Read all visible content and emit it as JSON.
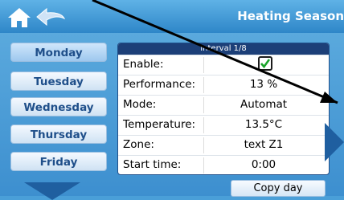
{
  "header": {
    "title": "Heating Season"
  },
  "days": [
    "Monday",
    "Tuesday",
    "Wednesday",
    "Thursday",
    "Friday"
  ],
  "selected_day": "Monday",
  "interval": {
    "title": "Interval 1/8",
    "rows": [
      {
        "label": "Enable:",
        "value": ""
      },
      {
        "label": "Performance:",
        "value": "13 %"
      },
      {
        "label": "Mode:",
        "value": "Automat"
      },
      {
        "label": "Temperature:",
        "value": "13.5°C"
      },
      {
        "label": "Zone:",
        "value": "text Z1"
      },
      {
        "label": "Start time:",
        "value": "0:00"
      }
    ],
    "enable_checked": true
  },
  "actions": {
    "copy_day": "Copy day"
  },
  "colors": {
    "check": "#1aa32a",
    "accent_dark": "#1c3f78",
    "arrow": "#1f5fa0"
  }
}
